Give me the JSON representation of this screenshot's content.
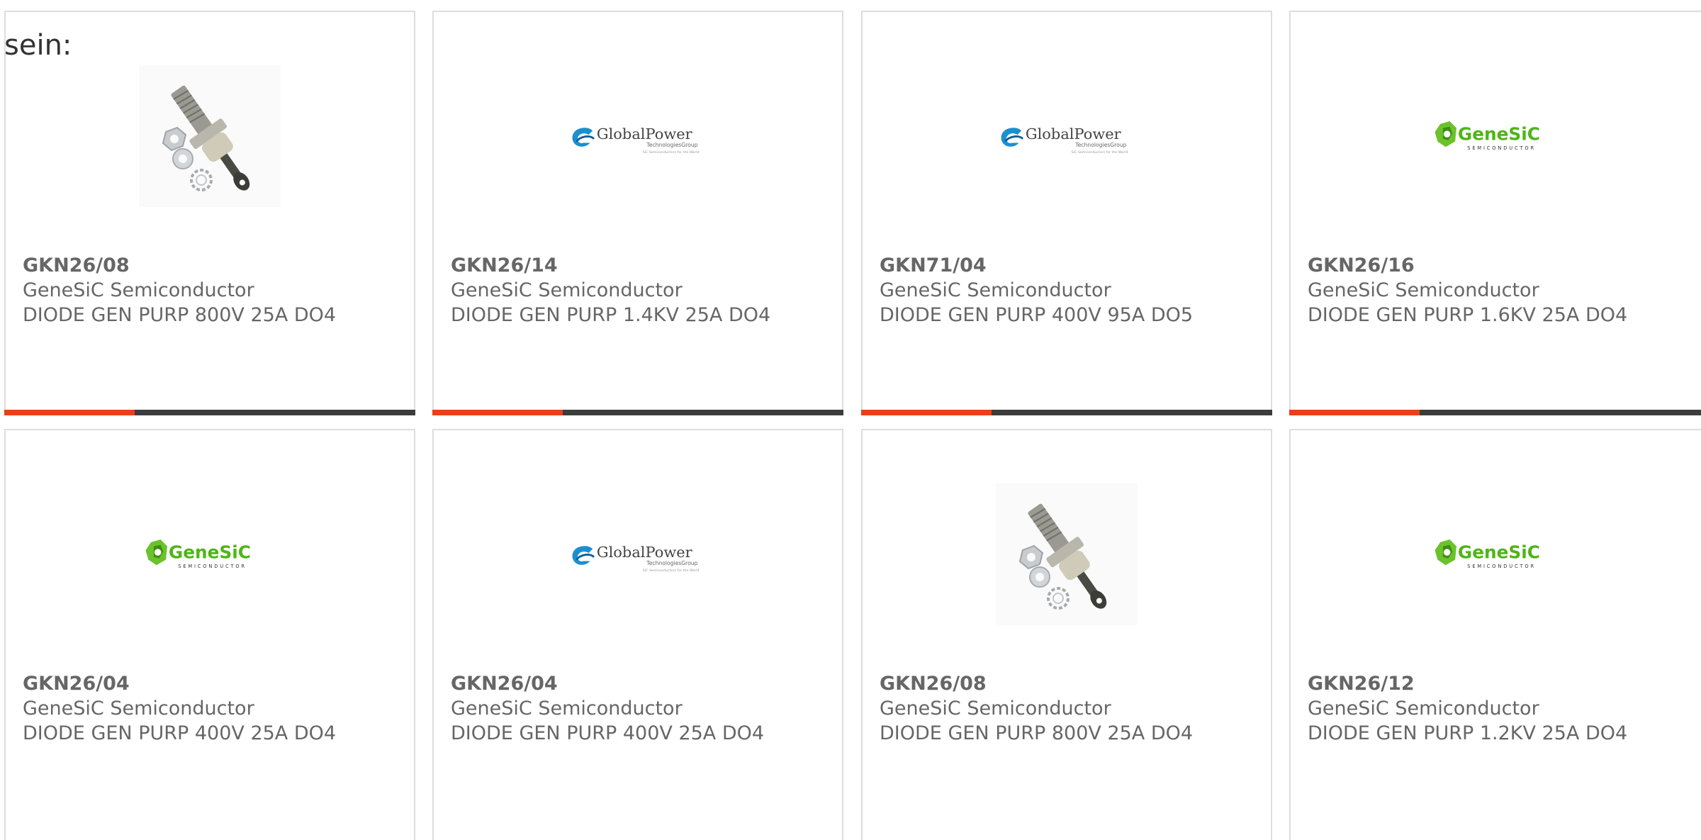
{
  "lead_text": "sein:",
  "colors": {
    "accent": "#e8401c",
    "bar_dark": "#3c3c3c",
    "card_border": "#dddddd",
    "text": "#666666"
  },
  "products": [
    {
      "part_number": "GKN26/08",
      "manufacturer": "GeneSiC Semiconductor",
      "description": "DIODE GEN PURP 800V 25A DO4",
      "image": "diode-stud-photo"
    },
    {
      "part_number": "GKN26/14",
      "manufacturer": "GeneSiC Semiconductor",
      "description": "DIODE GEN PURP 1.4KV 25A DO4",
      "image": "globalpower-logo"
    },
    {
      "part_number": "GKN71/04",
      "manufacturer": "GeneSiC Semiconductor",
      "description": "DIODE GEN PURP 400V 95A DO5",
      "image": "globalpower-logo"
    },
    {
      "part_number": "GKN26/16",
      "manufacturer": "GeneSiC Semiconductor",
      "description": "DIODE GEN PURP 1.6KV 25A DO4",
      "image": "genesic-logo"
    },
    {
      "part_number": "GKN26/04",
      "manufacturer": "GeneSiC Semiconductor",
      "description": "DIODE GEN PURP 400V 25A DO4",
      "image": "genesic-logo"
    },
    {
      "part_number": "GKN26/04",
      "manufacturer": "GeneSiC Semiconductor",
      "description": "DIODE GEN PURP 400V 25A DO4",
      "image": "globalpower-logo"
    },
    {
      "part_number": "GKN26/08",
      "manufacturer": "GeneSiC Semiconductor",
      "description": "DIODE GEN PURP 800V 25A DO4",
      "image": "diode-stud-photo"
    },
    {
      "part_number": "GKN26/12",
      "manufacturer": "GeneSiC Semiconductor",
      "description": "DIODE GEN PURP 1.2KV 25A DO4",
      "image": "genesic-logo"
    }
  ],
  "logos": {
    "globalpower": {
      "name": "GlobalPower",
      "sub": "TechnologiesGroup",
      "tagline": "SiC Semiconductors for the World"
    },
    "genesic": {
      "name": "GeneSiC",
      "sub": "SEMICONDUCTOR"
    }
  }
}
